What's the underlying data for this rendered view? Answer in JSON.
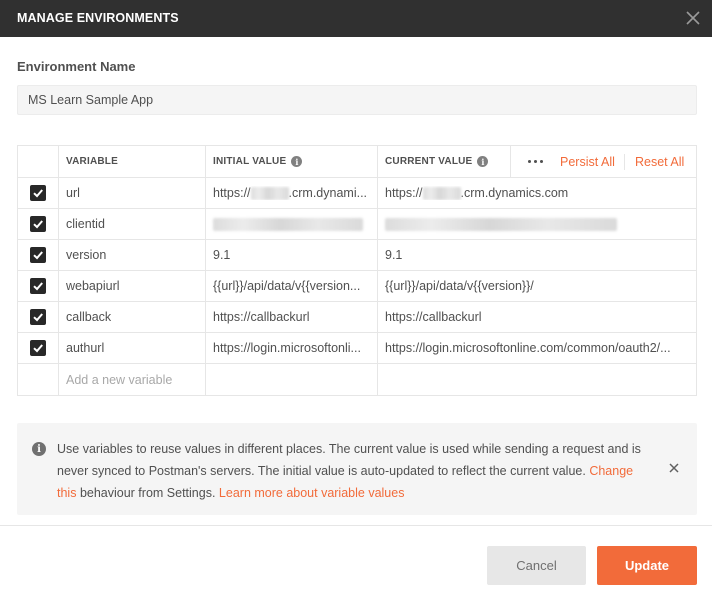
{
  "dialog": {
    "title": "MANAGE ENVIRONMENTS",
    "close_icon": "close-icon"
  },
  "environment": {
    "name_label": "Environment Name",
    "name_value": "MS Learn Sample App"
  },
  "table": {
    "headers": {
      "variable": "VARIABLE",
      "initial_value": "INITIAL VALUE",
      "current_value": "CURRENT VALUE",
      "info_icon": "info-icon"
    },
    "actions": {
      "more_icon": "more-horizontal-icon",
      "persist_all": "Persist All",
      "reset_all": "Reset All"
    },
    "rows": [
      {
        "checked": true,
        "variable": "url",
        "initial_prefix": "https://",
        "initial_suffix": ".crm.dynami...",
        "current_prefix": "https://",
        "current_suffix": ".crm.dynamics.com"
      },
      {
        "checked": true,
        "variable": "clientid",
        "initial_prefix": "",
        "initial_suffix": "",
        "current_prefix": "",
        "current_suffix": ""
      },
      {
        "checked": true,
        "variable": "version",
        "initial_value": "9.1",
        "current_value": "9.1"
      },
      {
        "checked": true,
        "variable": "webapiurl",
        "initial_value": "{{url}}/api/data/v{{version...",
        "current_value": "{{url}}/api/data/v{{version}}/"
      },
      {
        "checked": true,
        "variable": "callback",
        "initial_value": "https://callbackurl",
        "current_value": "https://callbackurl"
      },
      {
        "checked": true,
        "variable": "authurl",
        "initial_value": "https://login.microsoftonli...",
        "current_value": "https://login.microsoftonline.com/common/oauth2/..."
      }
    ],
    "new_variable_placeholder": "Add a new variable"
  },
  "info": {
    "icon": "info-icon",
    "text": "Use variables to reuse values in different places. The current value is used while sending a request and is never synced to Postman's servers. The initial value is auto-updated to reflect the current value.",
    "change_link": "Change this",
    "middle_text": "behaviour from Settings.",
    "learn_link": "Learn more about variable values",
    "close_icon": "close-icon"
  },
  "buttons": {
    "cancel": "Cancel",
    "update": "Update"
  },
  "colors": {
    "accent": "#f26b3a",
    "titlebar": "#303030"
  }
}
